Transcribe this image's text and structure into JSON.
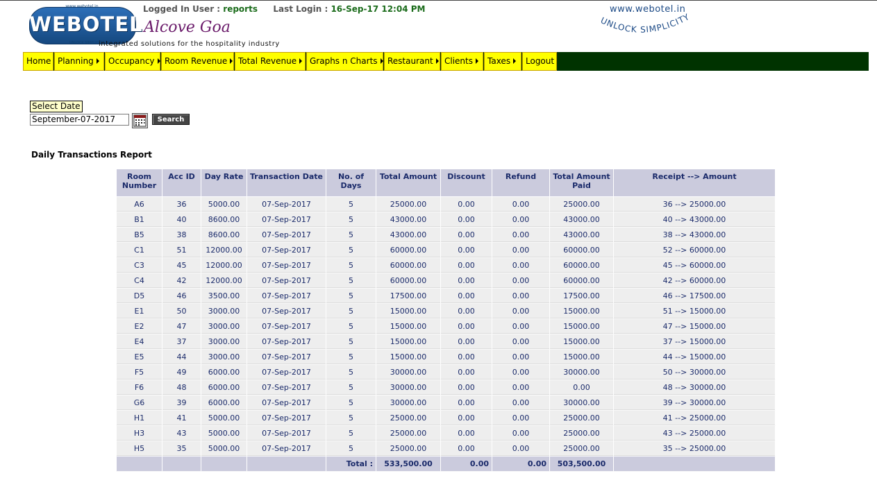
{
  "header": {
    "logo": {
      "url": "www.webotel.in",
      "word": "WEBOTEL",
      "tagline": "UNLOCK SIMPLICITY"
    },
    "login_user_label": "Logged In User :",
    "login_user": "reports",
    "last_login_label": "Last Login :",
    "last_login": "16-Sep-17 12:04 PM",
    "hotel_name": "Alcove Goa",
    "tagline": "integrated solutions for the hospitality industry",
    "website": "www.webotel.in",
    "unlock_text": "UNLOCK SIMPLICITY"
  },
  "nav": {
    "items": [
      {
        "label": "Home",
        "submenu": false
      },
      {
        "label": "Planning",
        "submenu": true
      },
      {
        "label": "Occupancy",
        "submenu": true
      },
      {
        "label": "Room Revenue",
        "submenu": true
      },
      {
        "label": "Total Revenue",
        "submenu": true
      },
      {
        "label": "Graphs n Charts",
        "submenu": true
      },
      {
        "label": "Restaurant",
        "submenu": true
      },
      {
        "label": "Clients",
        "submenu": true
      },
      {
        "label": "Taxes",
        "submenu": true
      },
      {
        "label": "Logout",
        "submenu": false
      }
    ],
    "bar_color": "#003300",
    "item_color": "#ffff00"
  },
  "filter": {
    "select_date_label": "Select Date",
    "date_value": "September-07-2017",
    "search_label": "Search"
  },
  "report": {
    "title": "Daily Transactions Report",
    "columns": [
      "Room Number",
      "Acc ID",
      "Day Rate",
      "Transaction Date",
      "No. of Days",
      "Total Amount",
      "Discount",
      "Refund",
      "Total Amount Paid",
      "Receipt --> Amount"
    ],
    "rows": [
      [
        "A6",
        "36",
        "5000.00",
        "07-Sep-2017",
        "5",
        "25000.00",
        "0.00",
        "0.00",
        "25000.00",
        "36 --> 25000.00"
      ],
      [
        "B1",
        "40",
        "8600.00",
        "07-Sep-2017",
        "5",
        "43000.00",
        "0.00",
        "0.00",
        "43000.00",
        "40 --> 43000.00"
      ],
      [
        "B5",
        "38",
        "8600.00",
        "07-Sep-2017",
        "5",
        "43000.00",
        "0.00",
        "0.00",
        "43000.00",
        "38 --> 43000.00"
      ],
      [
        "C1",
        "51",
        "12000.00",
        "07-Sep-2017",
        "5",
        "60000.00",
        "0.00",
        "0.00",
        "60000.00",
        "52 --> 60000.00"
      ],
      [
        "C3",
        "45",
        "12000.00",
        "07-Sep-2017",
        "5",
        "60000.00",
        "0.00",
        "0.00",
        "60000.00",
        "45 --> 60000.00"
      ],
      [
        "C4",
        "42",
        "12000.00",
        "07-Sep-2017",
        "5",
        "60000.00",
        "0.00",
        "0.00",
        "60000.00",
        "42 --> 60000.00"
      ],
      [
        "D5",
        "46",
        "3500.00",
        "07-Sep-2017",
        "5",
        "17500.00",
        "0.00",
        "0.00",
        "17500.00",
        "46 --> 17500.00"
      ],
      [
        "E1",
        "50",
        "3000.00",
        "07-Sep-2017",
        "5",
        "15000.00",
        "0.00",
        "0.00",
        "15000.00",
        "51 --> 15000.00"
      ],
      [
        "E2",
        "47",
        "3000.00",
        "07-Sep-2017",
        "5",
        "15000.00",
        "0.00",
        "0.00",
        "15000.00",
        "47 --> 15000.00"
      ],
      [
        "E4",
        "37",
        "3000.00",
        "07-Sep-2017",
        "5",
        "15000.00",
        "0.00",
        "0.00",
        "15000.00",
        "37 --> 15000.00"
      ],
      [
        "E5",
        "44",
        "3000.00",
        "07-Sep-2017",
        "5",
        "15000.00",
        "0.00",
        "0.00",
        "15000.00",
        "44 --> 15000.00"
      ],
      [
        "F5",
        "49",
        "6000.00",
        "07-Sep-2017",
        "5",
        "30000.00",
        "0.00",
        "0.00",
        "30000.00",
        "50 --> 30000.00"
      ],
      [
        "F6",
        "48",
        "6000.00",
        "07-Sep-2017",
        "5",
        "30000.00",
        "0.00",
        "0.00",
        "0.00",
        "48 --> 30000.00"
      ],
      [
        "G6",
        "39",
        "6000.00",
        "07-Sep-2017",
        "5",
        "30000.00",
        "0.00",
        "0.00",
        "30000.00",
        "39 --> 30000.00"
      ],
      [
        "H1",
        "41",
        "5000.00",
        "07-Sep-2017",
        "5",
        "25000.00",
        "0.00",
        "0.00",
        "25000.00",
        "41 --> 25000.00"
      ],
      [
        "H3",
        "43",
        "5000.00",
        "07-Sep-2017",
        "5",
        "25000.00",
        "0.00",
        "0.00",
        "25000.00",
        "43 --> 25000.00"
      ],
      [
        "H5",
        "35",
        "5000.00",
        "07-Sep-2017",
        "5",
        "25000.00",
        "0.00",
        "0.00",
        "25000.00",
        "35 --> 25000.00"
      ]
    ],
    "totals": {
      "label": "Total :",
      "total_amount": "533,500.00",
      "discount": "0.00",
      "refund": "0.00",
      "total_paid": "503,500.00"
    },
    "header_color": "#cbcbdd",
    "row_color": "#eeeeee",
    "text_color": "#1a2a6a"
  }
}
